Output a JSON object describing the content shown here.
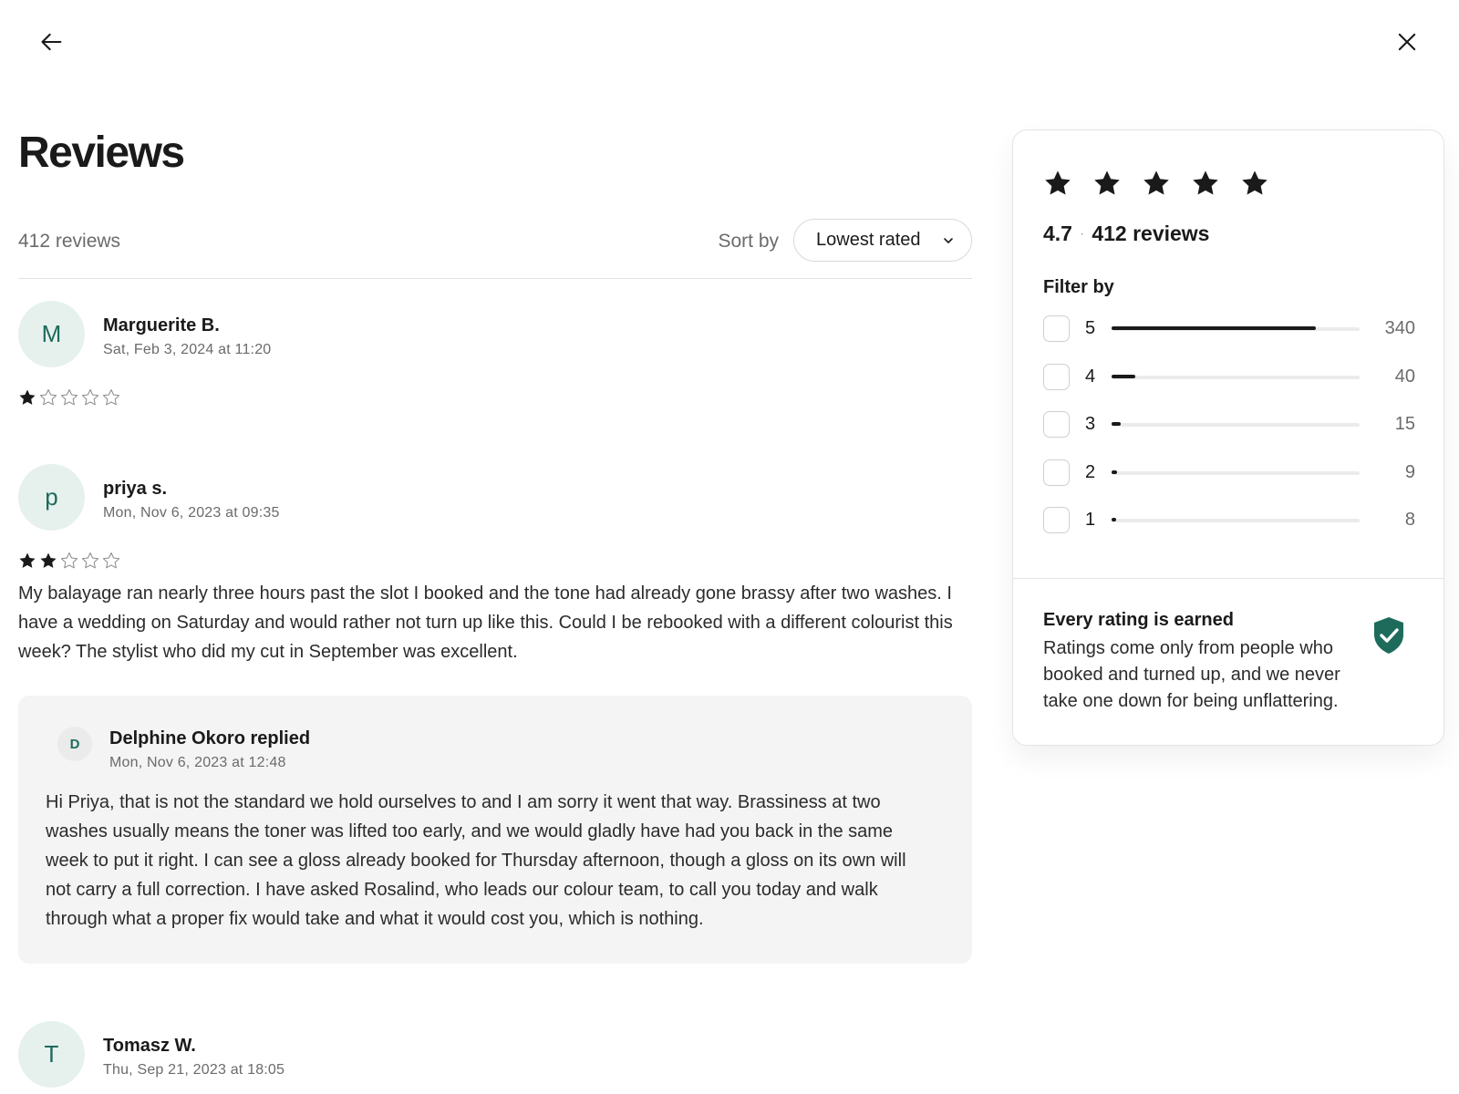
{
  "nav": {
    "back_icon": "arrow-left-icon",
    "close_icon": "close-icon"
  },
  "page": {
    "title": "Reviews"
  },
  "toolbar": {
    "review_count": "412 reviews",
    "sort_label": "Sort by",
    "sort_value": "Lowest rated"
  },
  "reviews": [
    {
      "initial": "M",
      "name": "Marguerite B.",
      "date": "Sat, Feb 3, 2024 at 11:20",
      "rating": 1,
      "body": ""
    },
    {
      "initial": "p",
      "name": "priya s.",
      "date": "Mon, Nov 6, 2023 at 09:35",
      "rating": 2,
      "body": "My balayage ran nearly three hours past the slot I booked and the tone had already gone brassy after two washes. I have a wedding on Saturday and would rather not turn up like this. Could I be rebooked with a different colourist this week? The stylist who did my cut in September was excellent.",
      "reply": {
        "initial": "D",
        "name": "Delphine Okoro replied",
        "date": "Mon, Nov 6, 2023 at 12:48",
        "body": "Hi Priya, that is not the standard we hold ourselves to and I am sorry it went that way. Brassiness at two washes usually means the toner was lifted too early, and we would gladly have had you back in the same week to put it right. I can see a gloss already booked for Thursday afternoon, though a gloss on its own will not carry a full correction. I have asked Rosalind, who leads our colour team, to call you today and walk through what a proper fix would take and what it would cost you, which is nothing."
      }
    },
    {
      "initial": "T",
      "name": "Tomasz W.",
      "date": "Thu, Sep 21, 2023 at 18:05"
    }
  ],
  "summary": {
    "rating": "4.7",
    "total": "412 reviews",
    "filter_label": "Filter by",
    "breakdown": [
      {
        "stars": "5",
        "count": "340",
        "fraction": 0.825
      },
      {
        "stars": "4",
        "count": "40",
        "fraction": 0.097
      },
      {
        "stars": "3",
        "count": "15",
        "fraction": 0.036
      },
      {
        "stars": "2",
        "count": "9",
        "fraction": 0.022
      },
      {
        "stars": "1",
        "count": "8",
        "fraction": 0.019
      }
    ],
    "guarantee_title": "Every rating is earned",
    "guarantee_text": "Ratings come only from people who booked and turned up, and we never take one down for being unflattering."
  },
  "colors": {
    "accent": "#1e6b5c",
    "avatar_bg": "#e6f1ee",
    "reply_bg": "#f4f4f4",
    "star": "#1a1a1a"
  }
}
